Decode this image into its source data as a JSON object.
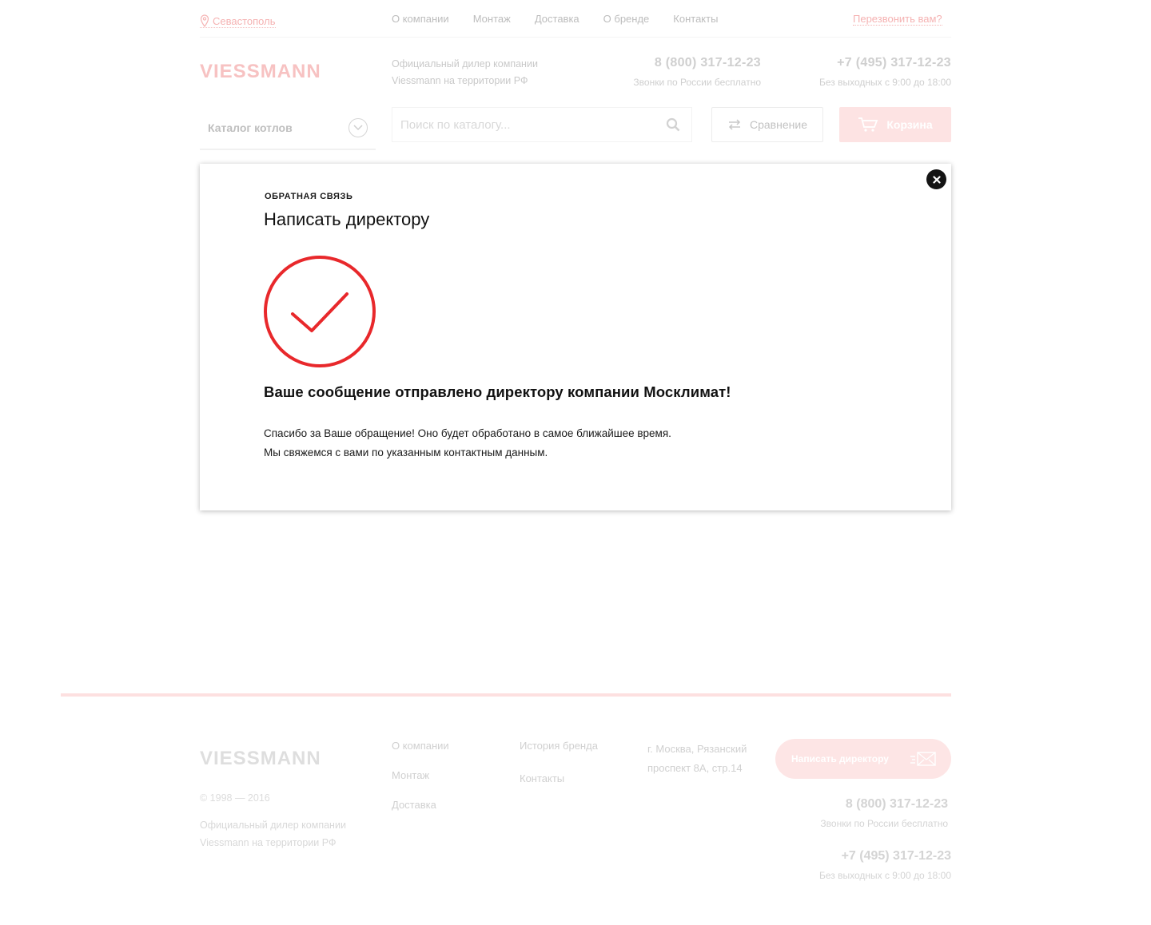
{
  "header": {
    "city": "Севастополь",
    "nav": [
      "О компании",
      "Монтаж",
      "Доставка",
      "О бренде",
      "Контакты"
    ],
    "callback": "Перезвонить вам?",
    "logo_text": "VIESSMANN",
    "dealer_line1": "Официальный дилер компании",
    "dealer_line2": "Viessmann на территории РФ",
    "phone1": "8 (800) 317-12-23",
    "phone1_note": "Звонки по России бесплатно",
    "phone2": "+7 (495) 317-12-23",
    "phone2_note": "Без выходных с 9:00 до 18:00",
    "catalog_label": "Каталог котлов",
    "search_placeholder": "Поиск по каталогу...",
    "compare_label": "Сравнение",
    "cart_label": "Корзина"
  },
  "modal": {
    "eyebrow": "ОБРАТНАЯ СВЯЗЬ",
    "title": "Написать директору",
    "message": "Ваше сообщение отправлено директору компании Москлимат!",
    "thanks_line1": "Спасибо за Ваше обращение! Оно будет обработано в самое ближайшее время.",
    "thanks_line2": "Мы свяжемся с вами по указанным контактным данным.",
    "accent_color": "#e8282b"
  },
  "footer": {
    "logo_text": "VIESSMANN",
    "copyright": "© 1998 — 2016",
    "dealer_line1": "Официальный дилер компании",
    "dealer_line2": "Viessmann на территории РФ",
    "col1": [
      "О компании",
      "Монтаж",
      "Доставка"
    ],
    "col2": [
      "История бренда",
      "Контакты"
    ],
    "address_line1": "г. Москва, Рязанский",
    "address_line2": "проспект 8А, стр.14",
    "write_label": "Написать директору",
    "phone1": "8 (800) 317-12-23",
    "phone1_note": "Звонки по России бесплатно",
    "phone2": "+7 (495) 317-12-23",
    "phone2_note": "Без выходных с 9:00 до 18:00"
  }
}
